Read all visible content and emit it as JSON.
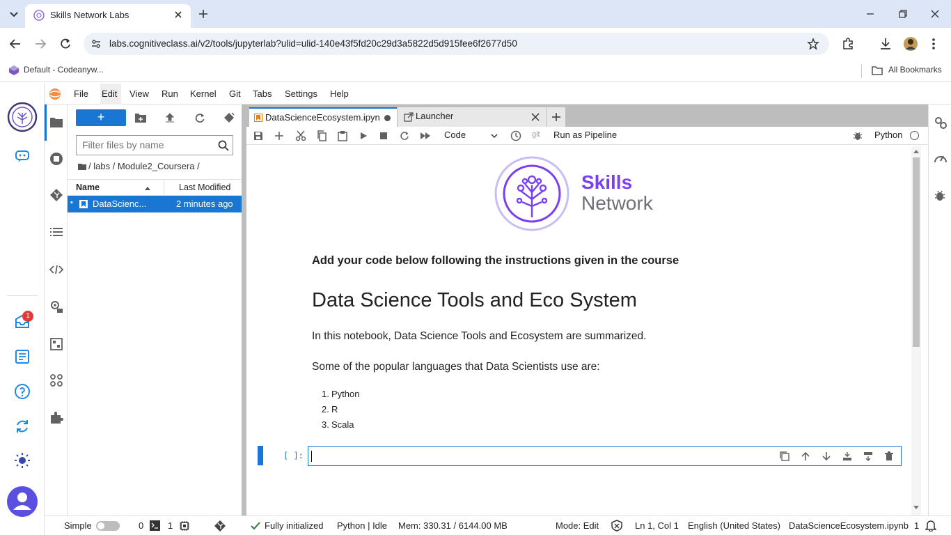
{
  "browser": {
    "tab_title": "Skills Network Labs",
    "url": "labs.cognitiveclass.ai/v2/tools/jupyterlab?ulid=ulid-140e43f5fd20c29d3a5822d5d915fee6f2677d50",
    "bookmark_item": "Default - Codeanyw...",
    "all_bookmarks": "All Bookmarks"
  },
  "menu": [
    "File",
    "Edit",
    "View",
    "Run",
    "Kernel",
    "Git",
    "Tabs",
    "Settings",
    "Help"
  ],
  "left_rail": {
    "inbox_badge": "1"
  },
  "file_browser": {
    "new_button": "+",
    "filter_placeholder": "Filter files by name",
    "breadcrumb": "/ labs / Module2_Coursera /",
    "col_name": "Name",
    "col_modified": "Last Modified",
    "rows": [
      {
        "name": "DataScienc...",
        "modified": "2 minutes ago"
      }
    ]
  },
  "tabs": [
    {
      "label": "DataScienceEcosystem.ipyn",
      "active": true
    },
    {
      "label": "Launcher",
      "active": false
    }
  ],
  "toolbar": {
    "cell_type": "Code",
    "git_label": "git",
    "run_pipeline": "Run as Pipeline",
    "kernel": "Python"
  },
  "notebook": {
    "logo_top": "Skills",
    "logo_bottom": "Network",
    "intro": "Add your code below following the instructions given in the course",
    "heading": "Data Science Tools and Eco System",
    "para1": "In this notebook, Data Science Tools and Ecosystem are summarized.",
    "para2": "Some of the popular languages that Data Scientists use are:",
    "list": [
      "Python",
      "R",
      "Scala"
    ],
    "prompt": "[ ]:"
  },
  "status": {
    "simple": "Simple",
    "terminals": "0",
    "kernels": "1",
    "init": "Fully initialized",
    "kernel_status": "Python | Idle",
    "mem": "Mem: 330.31 / 6144.00 MB",
    "mode": "Mode: Edit",
    "position": "Ln 1, Col 1",
    "language": "English (United States)",
    "filename": "DataScienceEcosystem.ipynb",
    "count": "1"
  },
  "colors": {
    "accent": "#1a73e8",
    "jupyter_blue": "#1976d2",
    "skills_purple": "#7b3ff2"
  }
}
